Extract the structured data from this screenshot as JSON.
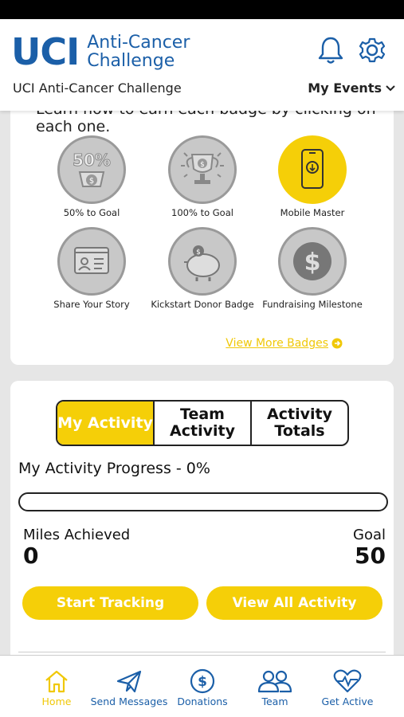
{
  "app": {
    "logo_main": "UCI",
    "logo_sub_line1": "Anti-Cancer",
    "logo_sub_line2": "Challenge",
    "org_name": "UCI Anti-Cancer Challenge",
    "my_events_label": "My Events",
    "brand_color": "#1b5fa8",
    "accent_color": "#f5cf08"
  },
  "badges": {
    "intro_text": "Learn how to earn each badge by clicking on each one.",
    "items": [
      {
        "label": "50% to Goal",
        "icon": "fifty-percent-badge-icon",
        "earned": false,
        "icon_text": "50%"
      },
      {
        "label": "100% to Goal",
        "icon": "trophy-badge-icon",
        "earned": false
      },
      {
        "label": "Mobile Master",
        "icon": "mobile-badge-icon",
        "earned": true
      },
      {
        "label": "Share Your Story",
        "icon": "profile-card-badge-icon",
        "earned": false
      },
      {
        "label": "Kickstart Donor Badge",
        "icon": "piggy-bank-badge-icon",
        "earned": false
      },
      {
        "label": "Fundraising Milestone",
        "icon": "dollar-coin-badge-icon",
        "earned": false
      }
    ],
    "view_more_label": "View More Badges"
  },
  "activity": {
    "tabs": [
      {
        "label": "My Activity",
        "active": true
      },
      {
        "label": "Team Activity",
        "active": false
      },
      {
        "label": "Activity Totals",
        "active": false
      }
    ],
    "progress_title": "My Activity Progress",
    "progress_suffix": " - 0%",
    "progress_fraction": 0,
    "miles_label": "Miles Achieved",
    "miles_value": "0",
    "goal_label": "Goal",
    "goal_value": "50",
    "start_tracking_label": "Start Tracking",
    "view_all_label": "View All Activity"
  },
  "nav": {
    "items": [
      {
        "label": "Home",
        "icon": "home-icon",
        "active": true
      },
      {
        "label": "Send Messages",
        "icon": "paper-plane-icon",
        "active": false
      },
      {
        "label": "Donations",
        "icon": "dollar-circle-icon",
        "active": false
      },
      {
        "label": "Team",
        "icon": "team-icon",
        "active": false
      },
      {
        "label": "Get Active",
        "icon": "heart-pulse-icon",
        "active": false
      }
    ]
  }
}
